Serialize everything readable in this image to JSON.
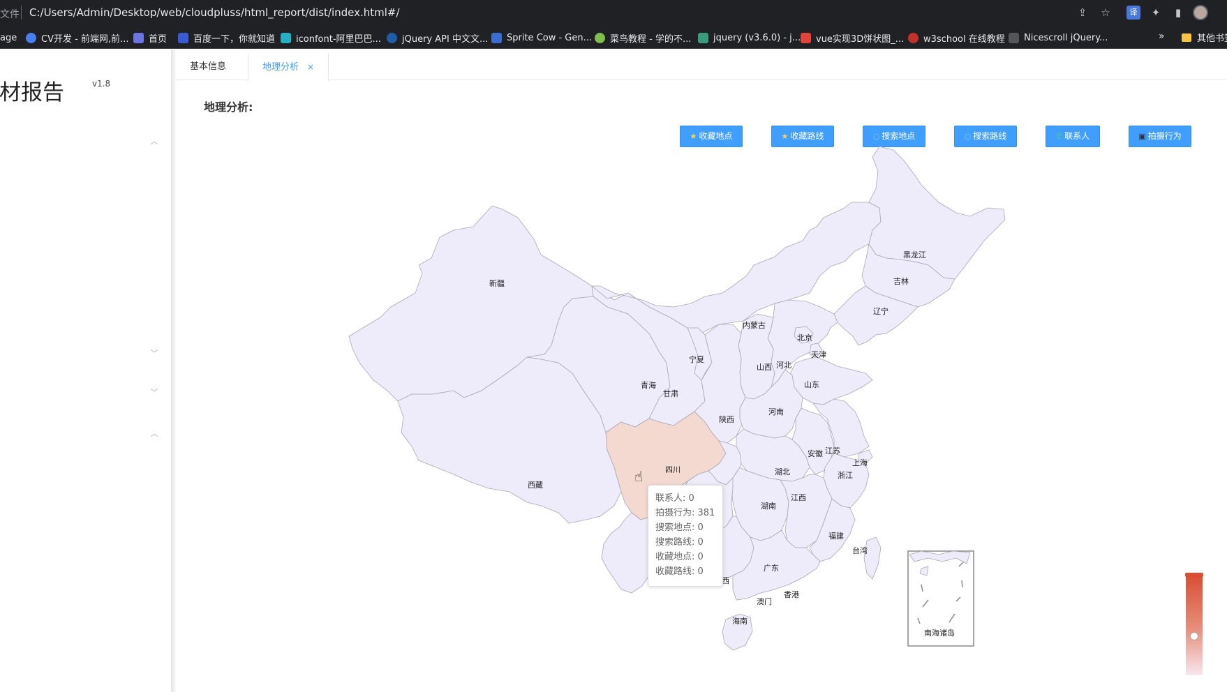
{
  "browser": {
    "file_label": "文件",
    "url": "C:/Users/Admin/Desktop/web/cloudpluss/html_report/dist/index.html#/",
    "toolbar_icons": [
      "share-icon",
      "star-icon",
      "translate-icon",
      "extensions-icon",
      "sidebar-icon"
    ]
  },
  "bookmarks": {
    "items": [
      "age",
      "CV开发 - 前端网,前...",
      "首页",
      "百度一下，你就知道",
      "iconfont-阿里巴巴...",
      "jQuery API 中文文...",
      "Sprite Cow - Gen...",
      "菜鸟教程 - 学的不...",
      "jquery (v3.6.0) - j...",
      "vue实现3D饼状图_...",
      "w3school 在线教程",
      "Nicescroll jQuery..."
    ],
    "more": "»",
    "folder": "其他书签"
  },
  "sidebar": {
    "title": "检材报告",
    "version": "v1.8"
  },
  "tabs": [
    {
      "label": "基本信息"
    },
    {
      "label": "地理分析",
      "close": "×"
    }
  ],
  "page": {
    "section_title": "地理分析:",
    "buttons": [
      {
        "label": "收藏地点",
        "icon": "star-icon"
      },
      {
        "label": "收藏路线",
        "icon": "star-icon"
      },
      {
        "label": "搜索地点",
        "icon": "search-icon"
      },
      {
        "label": "搜索路线",
        "icon": "search-icon"
      },
      {
        "label": "联系人",
        "icon": "phone-icon"
      },
      {
        "label": "拍摄行为",
        "icon": "camera-icon"
      }
    ]
  },
  "map": {
    "highlight_color": "#f3d9d0",
    "base_color": "#eeebfa",
    "provinces": {
      "xinjiang": "新疆",
      "xizang": "西藏",
      "qinghai": "青海",
      "gansu": "甘肃",
      "ningxia": "宁夏",
      "neimenggu": "内蒙古",
      "heilongjiang": "黑龙江",
      "jilin": "吉林",
      "liaoning": "辽宁",
      "beijing": "北京",
      "tianjin": "天津",
      "hebei": "河北",
      "shanxi": "山西",
      "shandong": "山东",
      "henan": "河南",
      "shaanxi": "陕西",
      "sichuan": "四川",
      "anhui": "安徽",
      "jiangsu": "江苏",
      "shanghai": "上海",
      "zhejiang": "浙江",
      "hubei": "湖北",
      "hunan": "湖南",
      "jiangxi": "江西",
      "fujian": "福建",
      "taiwan": "台湾",
      "guangdong": "广东",
      "guangxi": "西",
      "hongkong": "香港",
      "macau": "澳门",
      "hainan": "海南",
      "nanhai": "南海诸岛"
    },
    "tooltip": {
      "contacts": "联系人: 0",
      "photo": "拍摄行为: 381",
      "search_place": "搜索地点: 0",
      "search_route": "搜索路线: 0",
      "fav_place": "收藏地点: 0",
      "fav_route": "收藏路线: 0"
    }
  }
}
